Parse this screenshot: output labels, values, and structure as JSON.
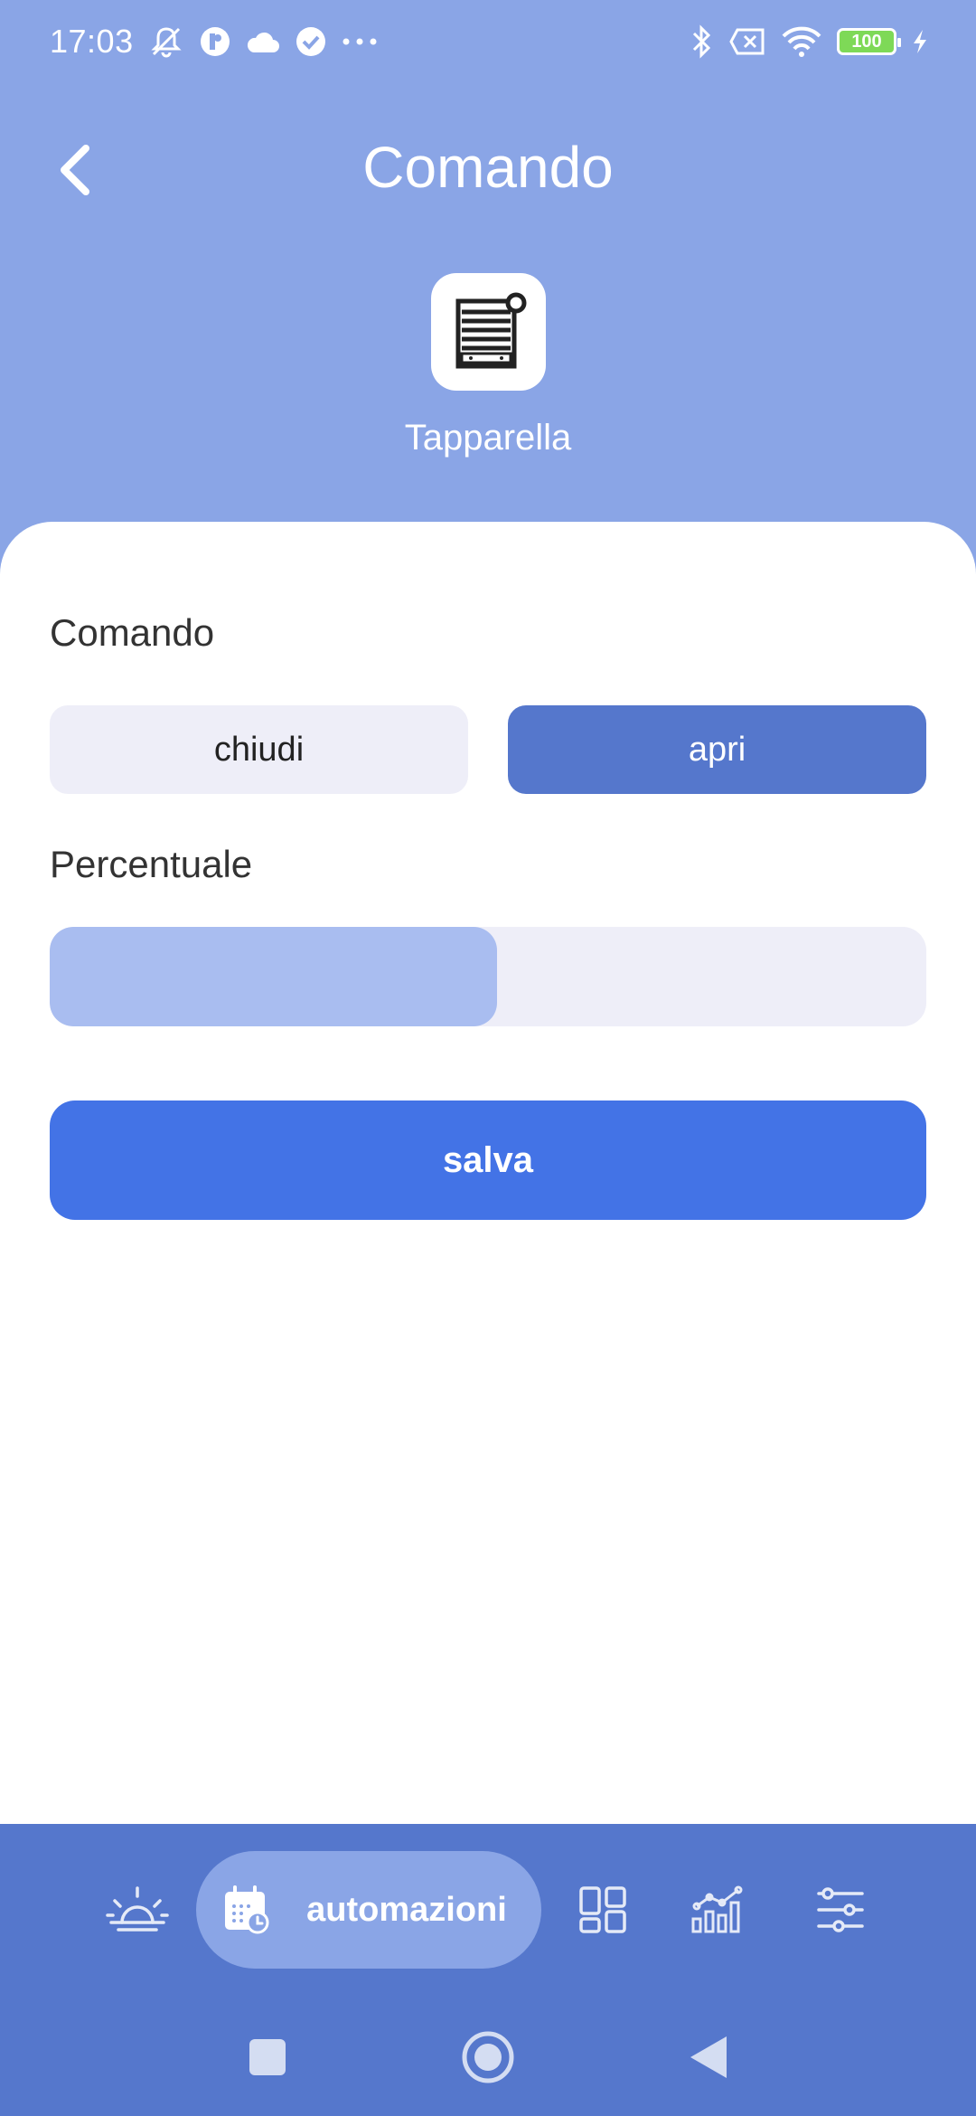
{
  "status_bar": {
    "time": "17:03",
    "battery_level": "100",
    "icons_left": [
      "mute-icon",
      "app-icon",
      "cloud-icon",
      "check-icon",
      "more-icon"
    ],
    "icons_right": [
      "bluetooth-icon",
      "no-sim-icon",
      "wifi-icon",
      "battery-icon",
      "charging-icon"
    ]
  },
  "header": {
    "title": "Comando",
    "device_name": "Tapparella",
    "device_icon": "roller-shutter-icon"
  },
  "form": {
    "command_label": "Comando",
    "options": [
      {
        "label": "chiudi",
        "selected": false
      },
      {
        "label": "apri",
        "selected": true
      }
    ],
    "percentage_label": "Percentuale",
    "percentage_value": 51,
    "save_label": "salva"
  },
  "colors": {
    "header_bg": "#8aa5e6",
    "accent": "#4373e6",
    "selected": "#5577cc",
    "nav_bg": "#5577cc",
    "slider_fill": "#a9bdf0"
  },
  "bottom_nav": {
    "items": [
      {
        "icon": "sunrise-icon",
        "label": "",
        "active": false
      },
      {
        "icon": "calendar-clock-icon",
        "label": "automazioni",
        "active": true
      },
      {
        "icon": "dashboard-icon",
        "label": "",
        "active": false
      },
      {
        "icon": "chart-icon",
        "label": "",
        "active": false
      },
      {
        "icon": "sliders-icon",
        "label": "",
        "active": false
      }
    ]
  }
}
